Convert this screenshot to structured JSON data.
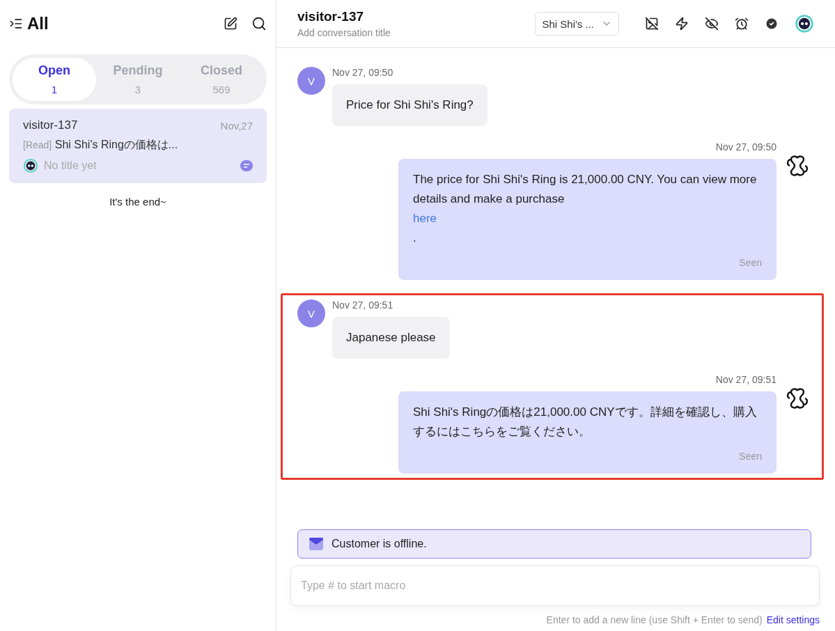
{
  "sidebar": {
    "title": "All",
    "tabs": [
      {
        "label": "Open",
        "count": "1",
        "selected": true
      },
      {
        "label": "Pending",
        "count": "3",
        "selected": false
      },
      {
        "label": "Closed",
        "count": "569",
        "selected": false
      }
    ],
    "conversations": [
      {
        "name": "visitor-137",
        "date": "Nov,27",
        "status": "[Read]",
        "preview": "Shi Shi's Ringの価格は...",
        "title": "No title yet",
        "selected": true
      }
    ],
    "end_text": "It's the end~"
  },
  "header": {
    "title": "visitor-137",
    "subtitle": "Add conversation title",
    "dropdown": "Shi Shi's ..."
  },
  "groups": [
    {
      "highlighted": false,
      "messages": [
        {
          "kind": "visitor",
          "avatar": "V",
          "time": "Nov 27, 09:50",
          "parts": [
            {
              "kind": "text",
              "text": "Price for Shi Shi's Ring?"
            }
          ]
        },
        {
          "kind": "agent",
          "time": "Nov 27, 09:50",
          "parts": [
            {
              "kind": "text",
              "text": "The price for Shi Shi's Ring is 21,000.00 CNY. You can view more details and make a purchase"
            },
            {
              "kind": "link",
              "text": "here"
            },
            {
              "kind": "text",
              "text": "."
            }
          ],
          "status": "Seen"
        }
      ]
    },
    {
      "highlighted": true,
      "messages": [
        {
          "kind": "visitor",
          "avatar": "V",
          "time": "Nov 27, 09:51",
          "parts": [
            {
              "kind": "text",
              "text": "Japanese please"
            }
          ]
        },
        {
          "kind": "agent",
          "time": "Nov 27, 09:51",
          "parts": [
            {
              "kind": "text",
              "text": "Shi Shi's Ringの価格は21,000.00 CNYです。詳細を確認し、購入するにはこちらをご覧ください。"
            }
          ],
          "status": "Seen"
        }
      ]
    }
  ],
  "notice": "Customer is offline.",
  "composer": {
    "placeholder": "Type # to start macro",
    "hint": "Enter to add a new line (use Shift + Enter to send)",
    "settings_link": "Edit settings"
  }
}
